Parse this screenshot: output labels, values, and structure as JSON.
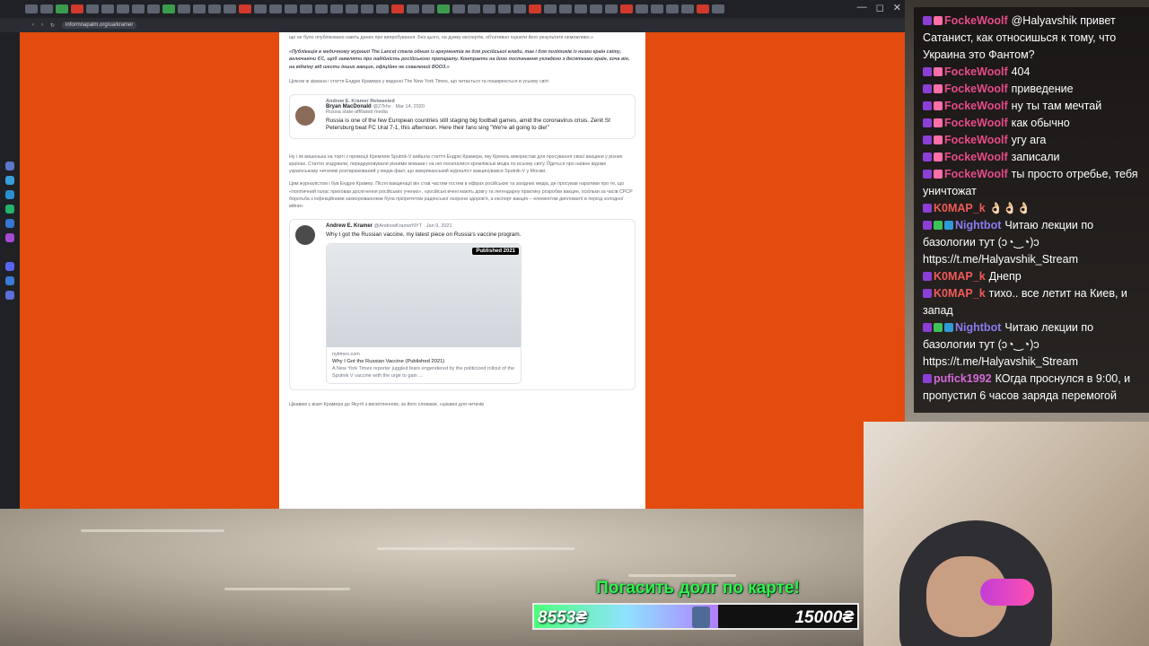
{
  "browser": {
    "url": "informnapalm.org/ua/kramer",
    "window_controls": [
      "—",
      "◻",
      "✕"
    ]
  },
  "article": {
    "para1": "що не було опубліковано навіть даних про випробування. Без цього, на думку експертів, об'єктивно оцінити його результати неможливо.»",
    "para2": "«Публікація в медичному журналі The Lancet стала одним із аргументів як для російської влади, так і для політиків із низки країн світу, включаючи ЄС, щоб заявляти про надійність російського препарату. Контракти на його постачання укладено з десятками країн, хоча він, на відміну від шести інших вакцин, офіційно не схвалений ВООЗ.»",
    "para3": "Цілком ж зірвана і стаття Ендрю Крамера у виданні The New York Times, що читається та поширюється в усьому світі",
    "para4": "Ну і як вишенька на торті з промоції Кремлем Sputnik-V вийшла стаття Ендрю Крамера, яку Кремль використав для просування своєї вакцини у різних країнах. Статтю згадували, передруковували різними мовами і на неї посилалися кремлівські медіа по всьому світу. Йдеться про наївне відоме українському читачеві розтиражований у медіа факт, що американський журналіст вакцинувався Sputnik-V у Москві.",
    "para5": "Цим журналістом і був Ендрю Крамер. Після вакцинації він став частим гостем в ефірах російських та західних медіа, де просував наративи про те, що «політичний галас приховав досягнення російських учених», «російські вчені мають довгу та легендарну практику розробки вакцин, оскільки за часів СРСР боротьба з інфекційними захворюваннями була пріоритетом радянської охорони здоров'я, а експорт вакцин – елементом дипломатії в період холодної війни»",
    "para6": "Цікавим є візит Крамера до Якутії з висвітленням, за його словами, «цікавої для читачів"
  },
  "tweet1": {
    "retweet_label": "Andrew E. Kramer Retweeted",
    "name": "Bryan MacDonald",
    "handle_date": "@27khv · Mar 14, 2020",
    "label": "Russia state-affiliated media",
    "body": "Russia is one of the few European countries still staging big football games, amid the coronavirus crisis. Zenit St Petersburg beat FC Ural 7-1, this afternoon. Here their fans sing \"We're all going to die!\""
  },
  "tweet2": {
    "name": "Andrew E. Kramer",
    "handle_date": "@AndrewKramerNYT · Jan 9, 2021",
    "body": "Why I got the Russian vaccine, my latest piece on Russia's vaccine program.",
    "badge": "Published 2021",
    "card_domain": "nytimes.com",
    "card_title": "Why I Got the Russian Vaccine (Published 2021)",
    "card_desc": "A New York Times reporter juggled fears engendered by the politicized rollout of the Sputnik V vaccine with the urge to gain ..."
  },
  "chat": {
    "messages": [
      {
        "user": "FockeWoolf",
        "color": "#e84a8a",
        "badges": [
          "#8c3fd6",
          "#ff6fa8"
        ],
        "text": "@Halyavshik привет Сатанист, как относишься к тому, что Украина это Фантом?"
      },
      {
        "user": "FockeWoolf",
        "color": "#e84a8a",
        "badges": [
          "#8c3fd6",
          "#ff6fa8"
        ],
        "text": "404"
      },
      {
        "user": "FockeWoolf",
        "color": "#e84a8a",
        "badges": [
          "#8c3fd6",
          "#ff6fa8"
        ],
        "text": "приведение"
      },
      {
        "user": "FockeWoolf",
        "color": "#e84a8a",
        "badges": [
          "#8c3fd6",
          "#ff6fa8"
        ],
        "text": "ну ты там мечтай"
      },
      {
        "user": "FockeWoolf",
        "color": "#e84a8a",
        "badges": [
          "#8c3fd6",
          "#ff6fa8"
        ],
        "text": "как обычно"
      },
      {
        "user": "FockeWoolf",
        "color": "#e84a8a",
        "badges": [
          "#8c3fd6",
          "#ff6fa8"
        ],
        "text": "угу ага"
      },
      {
        "user": "FockeWoolf",
        "color": "#e84a8a",
        "badges": [
          "#8c3fd6",
          "#ff6fa8"
        ],
        "text": "записали"
      },
      {
        "user": "FockeWoolf",
        "color": "#e84a8a",
        "badges": [
          "#8c3fd6",
          "#ff6fa8"
        ],
        "text": "ты просто отребье, тебя уничтожат"
      },
      {
        "user": "K0MAP_k",
        "color": "#f05a5a",
        "badges": [
          "#8c3fd6"
        ],
        "text": "👌🏻👌🏻👌🏻"
      },
      {
        "user": "Nightbot",
        "color": "#8a7cf0",
        "badges": [
          "#8c3fd6",
          "#3cc45a",
          "#2f9ad6"
        ],
        "text": "Читаю лекции по базологии тут (ↄ◔‿◔)ↄ https://t.me/Halyavshik_Stream"
      },
      {
        "user": "K0MAP_k",
        "color": "#f05a5a",
        "badges": [
          "#8c3fd6"
        ],
        "text": "Днепр"
      },
      {
        "user": "K0MAP_k",
        "color": "#f05a5a",
        "badges": [
          "#8c3fd6"
        ],
        "text": "тихо.. все летит на Киев, и запад"
      },
      {
        "user": "Nightbot",
        "color": "#8a7cf0",
        "badges": [
          "#8c3fd6",
          "#3cc45a",
          "#2f9ad6"
        ],
        "text": "Читаю лекции по базологии тут (ↄ◔‿◔)ↄ https://t.me/Halyavshik_Stream"
      },
      {
        "user": "pufick1992",
        "color": "#d56ad8",
        "badges": [
          "#8c3fd6"
        ],
        "text": "КОгда проснулся в 9:00, и пропустил 6 часов заряда перемогой"
      }
    ]
  },
  "goal": {
    "title": "Погасить долг по карте!",
    "current": "8553₴",
    "target": "15000₴",
    "progress": 0.57
  }
}
